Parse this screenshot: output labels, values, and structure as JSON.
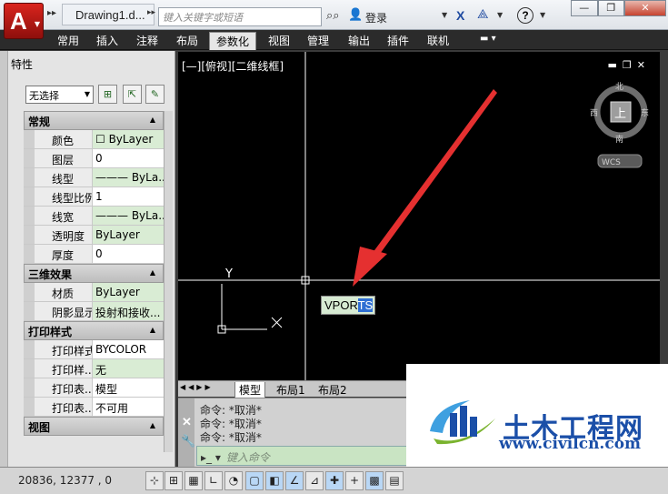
{
  "titlebar": {
    "doc_title": "Drawing1.d...",
    "search_placeholder": "键入关键字或短语",
    "login": "登录",
    "help": "?"
  },
  "ribbon": {
    "tabs": [
      "常用",
      "插入",
      "注释",
      "布局",
      "参数化",
      "视图",
      "管理",
      "输出",
      "插件",
      "联机"
    ],
    "active_tab": "参数化"
  },
  "properties": {
    "title": "特性",
    "selection": "无选择",
    "groups": [
      {
        "name": "常规",
        "rows": [
          {
            "label": "颜色",
            "value": "☐ ByLayer",
            "hl": true
          },
          {
            "label": "图层",
            "value": "0",
            "hl": false
          },
          {
            "label": "线型",
            "value": "——— ByLa...",
            "hl": true
          },
          {
            "label": "线型比例",
            "value": "1",
            "hl": false
          },
          {
            "label": "线宽",
            "value": "——— ByLa...",
            "hl": true
          },
          {
            "label": "透明度",
            "value": "ByLayer",
            "hl": true
          },
          {
            "label": "厚度",
            "value": "0",
            "hl": false
          }
        ]
      },
      {
        "name": "三维效果",
        "rows": [
          {
            "label": "材质",
            "value": "ByLayer",
            "hl": true
          },
          {
            "label": "阴影显示",
            "value": "投射和接收...",
            "hl": true
          }
        ]
      },
      {
        "name": "打印样式",
        "rows": [
          {
            "label": "打印样式",
            "value": "BYCOLOR",
            "hl": false
          },
          {
            "label": "打印样...",
            "value": "无",
            "hl": true
          },
          {
            "label": "打印表...",
            "value": "模型",
            "hl": false
          },
          {
            "label": "打印表...",
            "value": "不可用",
            "hl": false
          }
        ]
      },
      {
        "name": "视图",
        "rows": []
      }
    ]
  },
  "viewport": {
    "label": "[—][俯视][二维线框]",
    "compass": {
      "north": "北",
      "south": "南",
      "east": "东",
      "west": "西",
      "top": "上"
    },
    "wcs": "WCS",
    "ucs_y": "Y",
    "command_tip": {
      "typed": "VPOR",
      "selected": "TS"
    }
  },
  "layout_tabs": [
    "模型",
    "布局1",
    "布局2"
  ],
  "command": {
    "history": [
      "命令: *取消*",
      "命令: *取消*",
      "命令: *取消*"
    ],
    "input_placeholder": "键入命令"
  },
  "statusbar": {
    "coords": "20836,  12377 , 0"
  },
  "watermark": {
    "cn": "土木工程网",
    "url": "www.civilcn.com"
  },
  "colors": {
    "viewport_bg": "#000000",
    "arrow": "#e53030",
    "accent_blue": "#1b4fa8"
  }
}
